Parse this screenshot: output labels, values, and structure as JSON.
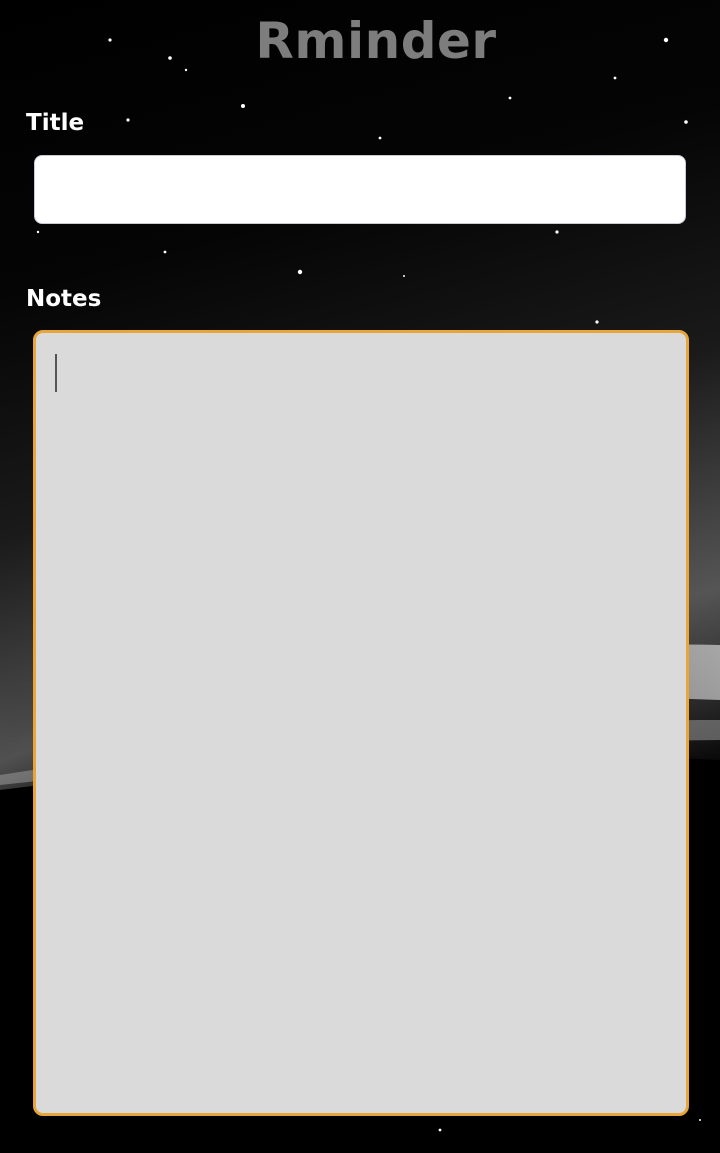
{
  "app": {
    "title": "Rminder"
  },
  "form": {
    "title_label": "Title",
    "title_value": "",
    "title_placeholder": "",
    "notes_label": "Notes",
    "notes_value": "",
    "notes_placeholder": ""
  },
  "colors": {
    "background": "#000000",
    "title_text": "#7d7d7d",
    "label_text": "#ffffff",
    "notes_focus_border": "#e7a53a",
    "notes_background": "#dadada",
    "title_input_background": "#ffffff"
  },
  "state": {
    "focused_field": "notes"
  }
}
